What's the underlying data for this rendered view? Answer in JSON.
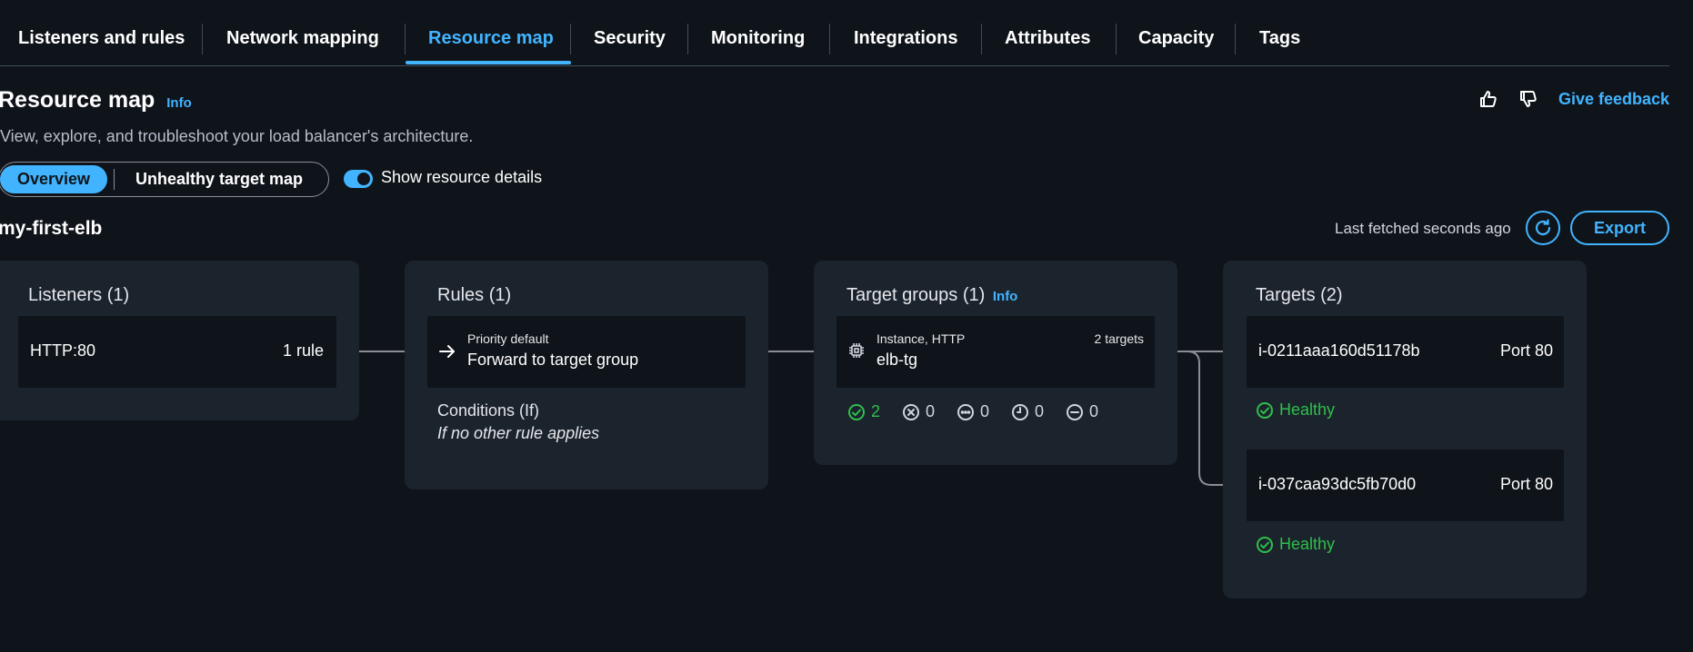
{
  "tabs": [
    {
      "label": "Listeners and rules"
    },
    {
      "label": "Network mapping"
    },
    {
      "label": "Resource map"
    },
    {
      "label": "Security"
    },
    {
      "label": "Monitoring"
    },
    {
      "label": "Integrations"
    },
    {
      "label": "Attributes"
    },
    {
      "label": "Capacity"
    },
    {
      "label": "Tags"
    }
  ],
  "active_tab": "Resource map",
  "header": {
    "title": "Resource map",
    "info": "Info",
    "description": "View, explore, and troubleshoot your load balancer's architecture.",
    "feedback_label": "Give feedback"
  },
  "view_toggle": {
    "overview": "Overview",
    "unhealthy": "Unhealthy target map",
    "show_details": "Show resource details",
    "show_details_on": true
  },
  "load_balancer": {
    "name": "my-first-elb",
    "last_fetched": "Last fetched seconds ago",
    "export_label": "Export"
  },
  "listeners": {
    "title": "Listeners (1)",
    "items": [
      {
        "protocol": "HTTP:80",
        "rules": "1 rule"
      }
    ]
  },
  "rules": {
    "title": "Rules (1)",
    "priority": "Priority default",
    "action": "Forward to target group",
    "conditions_label": "Conditions (If)",
    "conditions_value": "If no other rule applies"
  },
  "target_groups": {
    "title": "Target groups (1)",
    "info": "Info",
    "type": "Instance, HTTP",
    "targets_count": "2 targets",
    "name": "elb-tg",
    "stats": {
      "healthy": "2",
      "unhealthy": "0",
      "unused": "0",
      "initial": "0",
      "draining": "0"
    }
  },
  "targets": {
    "title": "Targets (2)",
    "items": [
      {
        "id": "i-0211aaa160d51178b",
        "port": "Port 80",
        "status": "Healthy"
      },
      {
        "id": "i-037caa93dc5fb70d0",
        "port": "Port 80",
        "status": "Healthy"
      }
    ]
  },
  "colors": {
    "accent": "#42b4ff",
    "healthy": "#2fbf4a",
    "card": "#1b232d",
    "background": "#0f141a"
  }
}
